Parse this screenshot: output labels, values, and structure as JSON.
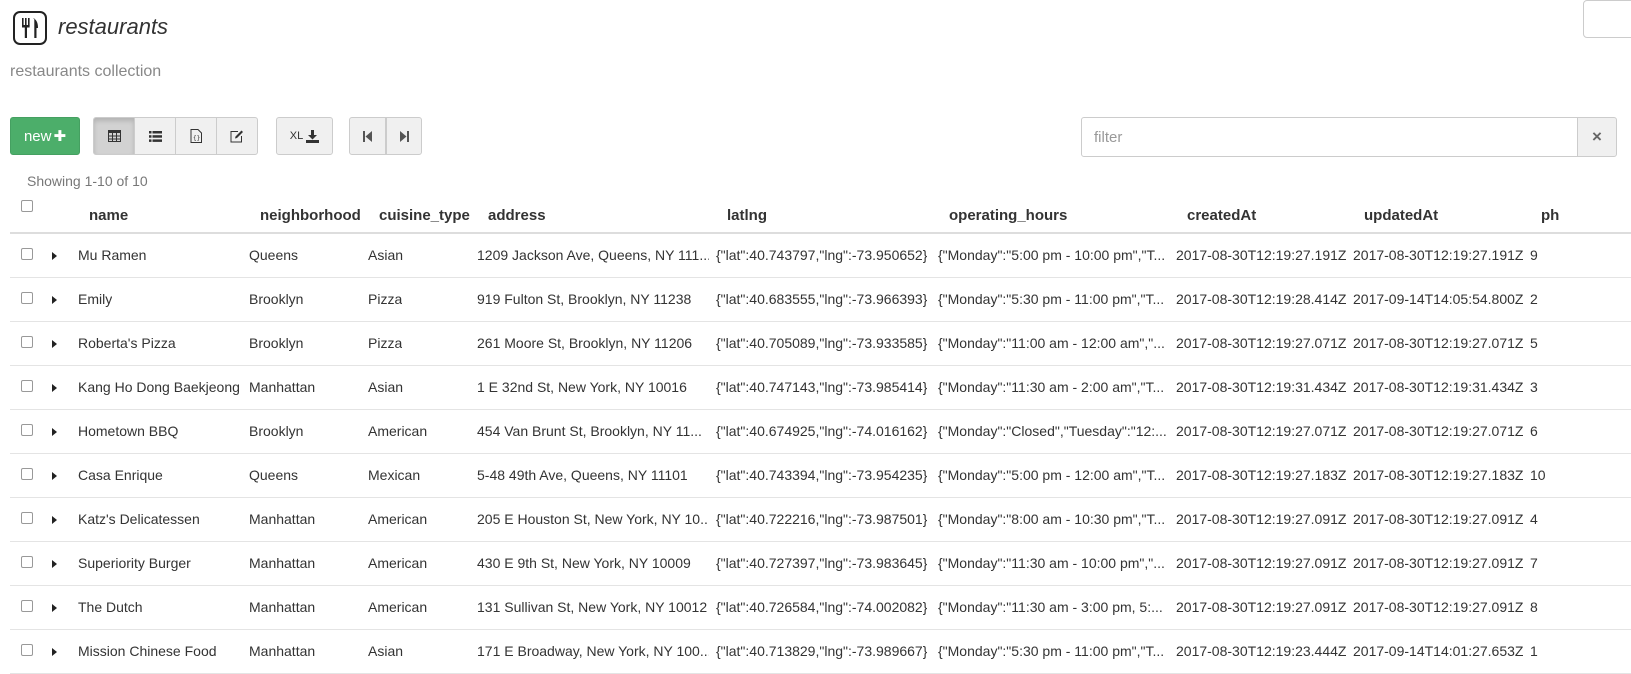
{
  "header": {
    "icon": "fork-knife-icon",
    "title": "restaurants",
    "subtitle": "restaurants collection"
  },
  "toolbar": {
    "new_label": "new",
    "new_color": "#4cae6a",
    "view_buttons": [
      "table-view-icon",
      "list-view-icon",
      "json-view-icon",
      "edit-view-icon"
    ],
    "export_label": "XL",
    "filter_placeholder": "filter",
    "clear_label": "×"
  },
  "status": {
    "showing": "Showing 1-10 of 10"
  },
  "table": {
    "columns": [
      "name",
      "neighborhood",
      "cuisine_type",
      "address",
      "latlng",
      "operating_hours",
      "createdAt",
      "updatedAt",
      "ph"
    ],
    "rows": [
      {
        "name": "Mu Ramen",
        "neighborhood": "Queens",
        "cuisine_type": "Asian",
        "address": "1209 Jackson Ave, Queens, NY 111...",
        "latlng": "{\"lat\":40.743797,\"lng\":-73.950652}",
        "operating_hours": "{\"Monday\":\"5:00 pm - 10:00 pm\",\"T...",
        "createdAt": "2017-08-30T12:19:27.191Z",
        "updatedAt": "2017-08-30T12:19:27.191Z",
        "ph": "9"
      },
      {
        "name": "Emily",
        "neighborhood": "Brooklyn",
        "cuisine_type": "Pizza",
        "address": "919 Fulton St, Brooklyn, NY 11238",
        "latlng": "{\"lat\":40.683555,\"lng\":-73.966393}",
        "operating_hours": "{\"Monday\":\"5:30 pm - 11:00 pm\",\"T...",
        "createdAt": "2017-08-30T12:19:28.414Z",
        "updatedAt": "2017-09-14T14:05:54.800Z",
        "ph": "2"
      },
      {
        "name": "Roberta's Pizza",
        "neighborhood": "Brooklyn",
        "cuisine_type": "Pizza",
        "address": "261 Moore St, Brooklyn, NY 11206",
        "latlng": "{\"lat\":40.705089,\"lng\":-73.933585}",
        "operating_hours": "{\"Monday\":\"11:00 am - 12:00 am\",\"...",
        "createdAt": "2017-08-30T12:19:27.071Z",
        "updatedAt": "2017-08-30T12:19:27.071Z",
        "ph": "5"
      },
      {
        "name": "Kang Ho Dong Baekjeong",
        "neighborhood": "Manhattan",
        "cuisine_type": "Asian",
        "address": "1 E 32nd St, New York, NY 10016",
        "latlng": "{\"lat\":40.747143,\"lng\":-73.985414}",
        "operating_hours": "{\"Monday\":\"11:30 am - 2:00 am\",\"T...",
        "createdAt": "2017-08-30T12:19:31.434Z",
        "updatedAt": "2017-08-30T12:19:31.434Z",
        "ph": "3"
      },
      {
        "name": "Hometown BBQ",
        "neighborhood": "Brooklyn",
        "cuisine_type": "American",
        "address": "454 Van Brunt St, Brooklyn, NY 11...",
        "latlng": "{\"lat\":40.674925,\"lng\":-74.016162}",
        "operating_hours": "{\"Monday\":\"Closed\",\"Tuesday\":\"12:...",
        "createdAt": "2017-08-30T12:19:27.071Z",
        "updatedAt": "2017-08-30T12:19:27.071Z",
        "ph": "6"
      },
      {
        "name": "Casa Enrique",
        "neighborhood": "Queens",
        "cuisine_type": "Mexican",
        "address": "5-48 49th Ave, Queens, NY 11101",
        "latlng": "{\"lat\":40.743394,\"lng\":-73.954235}",
        "operating_hours": "{\"Monday\":\"5:00 pm - 12:00 am\",\"T...",
        "createdAt": "2017-08-30T12:19:27.183Z",
        "updatedAt": "2017-08-30T12:19:27.183Z",
        "ph": "10"
      },
      {
        "name": "Katz's Delicatessen",
        "neighborhood": "Manhattan",
        "cuisine_type": "American",
        "address": "205 E Houston St, New York, NY 10...",
        "latlng": "{\"lat\":40.722216,\"lng\":-73.987501}",
        "operating_hours": "{\"Monday\":\"8:00 am - 10:30 pm\",\"T...",
        "createdAt": "2017-08-30T12:19:27.091Z",
        "updatedAt": "2017-08-30T12:19:27.091Z",
        "ph": "4"
      },
      {
        "name": "Superiority Burger",
        "neighborhood": "Manhattan",
        "cuisine_type": "American",
        "address": "430 E 9th St, New York, NY 10009",
        "latlng": "{\"lat\":40.727397,\"lng\":-73.983645}",
        "operating_hours": "{\"Monday\":\"11:30 am - 10:00 pm\",\"...",
        "createdAt": "2017-08-30T12:19:27.091Z",
        "updatedAt": "2017-08-30T12:19:27.091Z",
        "ph": "7"
      },
      {
        "name": "The Dutch",
        "neighborhood": "Manhattan",
        "cuisine_type": "American",
        "address": "131 Sullivan St, New York, NY 10012",
        "latlng": "{\"lat\":40.726584,\"lng\":-74.002082}",
        "operating_hours": "{\"Monday\":\"11:30 am - 3:00 pm, 5:...",
        "createdAt": "2017-08-30T12:19:27.091Z",
        "updatedAt": "2017-08-30T12:19:27.091Z",
        "ph": "8"
      },
      {
        "name": "Mission Chinese Food",
        "neighborhood": "Manhattan",
        "cuisine_type": "Asian",
        "address": "171 E Broadway, New York, NY 100...",
        "latlng": "{\"lat\":40.713829,\"lng\":-73.989667}",
        "operating_hours": "{\"Monday\":\"5:30 pm - 11:00 pm\",\"T...",
        "createdAt": "2017-08-30T12:19:23.444Z",
        "updatedAt": "2017-09-14T14:01:27.653Z",
        "ph": "1"
      }
    ]
  }
}
